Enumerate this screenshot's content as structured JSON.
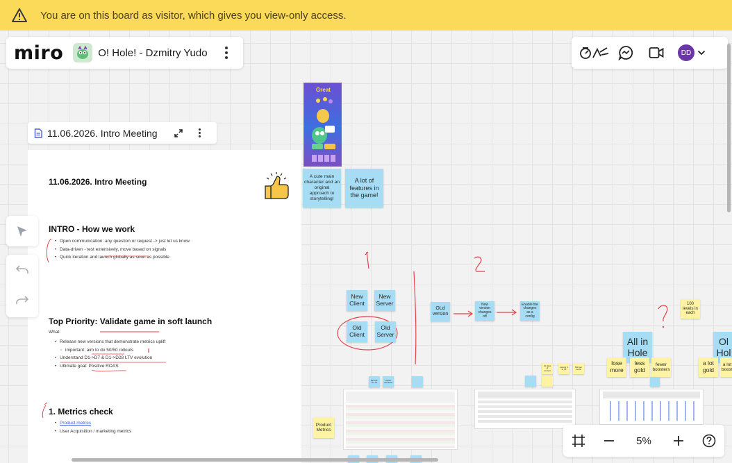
{
  "banner": {
    "message": "You are on this board as visitor, which gives you view-only access.",
    "icon": "warning-icon"
  },
  "board": {
    "logo": "miro",
    "title": "O! Hole! - Dzmitry Yudo"
  },
  "user": {
    "initials": "DD",
    "color": "#6a36a8"
  },
  "document": {
    "header_title": "11.06.2026. Intro Meeting",
    "title": "11.06.2026. Intro Meeting",
    "intro": {
      "heading": "INTRO - How we work",
      "items": [
        "Open communication: any question or request -> just let us know",
        "Data-driven - test extensively, move based on signals",
        "Quick iteration and launch globally as soon as possible"
      ]
    },
    "priority": {
      "heading": "Top Priority: Validate game in soft launch",
      "what": "What:",
      "items": [
        "Release new versions that demonstrate metrics uplift",
        "important: aim to do 50/50 rollouts",
        "Understand D1->D7 & D1->D28 LTV evolution",
        "Ultimate goal: Positive ROAS"
      ]
    },
    "metrics": {
      "heading": "1. Metrics check",
      "items": [
        "Product metrics",
        "User Acquisition / marketing metrics"
      ]
    }
  },
  "canvas": {
    "game_banner_text": "Great",
    "sticky_story": "A cute main character and an original approach to storytelling!",
    "sticky_features": "A lot of features in the game!",
    "hand_1": "1",
    "hand_2": "2",
    "hand_q": "?",
    "new_client": "New Client",
    "new_server": "New Server",
    "old_client": "Old Client",
    "old_server": "Old Server",
    "old_version": "OLd version",
    "new_version": "New version changes off",
    "enable_changes": "Enable the changes as a config",
    "levels": "100 levels in each",
    "all_in_hole": "All in Hole",
    "lose_more": "lose more",
    "less_gold": "less gold",
    "fewer_boosters": "fewer boosters",
    "a_lot_gold": "a lot gold",
    "a_lot_boosters": "a lot boost",
    "old_hole_partial": "Ol Hol",
    "product_metrics": "Product Metrics",
    "tiny_a": "Ref D1-D7 ok",
    "tiny_b": "Active soft level",
    "tiny_c": "10 days of content",
    "tiny_d": "paying 3 to 50",
    "tiny_e": "500 per month"
  },
  "zoom": {
    "level": "5%"
  },
  "colors": {
    "banner": "#fbd959",
    "sticky_blue": "#a6ddf5",
    "sticky_yellow": "#fdf3a3",
    "annotation_red": "#e0434b",
    "accent_purple": "#6a36a8"
  }
}
